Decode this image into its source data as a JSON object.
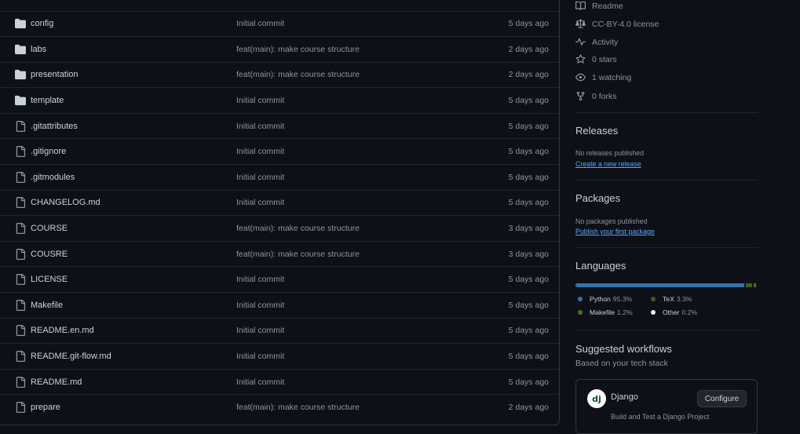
{
  "files": [
    {
      "type": "folder",
      "name": "config",
      "message": "Initial commit",
      "age": "5 days ago"
    },
    {
      "type": "folder",
      "name": "labs",
      "message": "feat(main): make course structure",
      "age": "2 days ago"
    },
    {
      "type": "folder",
      "name": "presentation",
      "message": "feat(main): make course structure",
      "age": "2 days ago"
    },
    {
      "type": "folder",
      "name": "template",
      "message": "Initial commit",
      "age": "5 days ago"
    },
    {
      "type": "file",
      "name": ".gitattributes",
      "message": "Initial commit",
      "age": "5 days ago"
    },
    {
      "type": "file",
      "name": ".gitignore",
      "message": "Initial commit",
      "age": "5 days ago"
    },
    {
      "type": "file",
      "name": ".gitmodules",
      "message": "Initial commit",
      "age": "5 days ago"
    },
    {
      "type": "file",
      "name": "CHANGELOG.md",
      "message": "Initial commit",
      "age": "5 days ago"
    },
    {
      "type": "file",
      "name": "COURSE",
      "message": "feat(main): make course structure",
      "age": "3 days ago"
    },
    {
      "type": "file",
      "name": "COUSRE",
      "message": "feat(main): make course structure",
      "age": "3 days ago"
    },
    {
      "type": "file",
      "name": "LICENSE",
      "message": "Initial commit",
      "age": "5 days ago"
    },
    {
      "type": "file",
      "name": "Makefile",
      "message": "Initial commit",
      "age": "5 days ago"
    },
    {
      "type": "file",
      "name": "README.en.md",
      "message": "Initial commit",
      "age": "5 days ago"
    },
    {
      "type": "file",
      "name": "README.git-flow.md",
      "message": "Initial commit",
      "age": "5 days ago"
    },
    {
      "type": "file",
      "name": "README.md",
      "message": "Initial commit",
      "age": "5 days ago"
    },
    {
      "type": "file",
      "name": "prepare",
      "message": "feat(main): make course structure",
      "age": "2 days ago"
    }
  ],
  "about": {
    "readme": "Readme",
    "license": "CC-BY-4.0 license",
    "activity": "Activity",
    "stars": "0 stars",
    "watching": "1 watching",
    "forks": "0 forks"
  },
  "releases": {
    "title": "Releases",
    "empty": "No releases published",
    "link": "Create a new release"
  },
  "packages": {
    "title": "Packages",
    "empty": "No packages published",
    "link": "Publish your first package"
  },
  "languages": {
    "title": "Languages",
    "items": [
      {
        "name": "Python",
        "pct": "95.3%",
        "value": 95.3,
        "color": "#3572A5"
      },
      {
        "name": "TeX",
        "pct": "3.3%",
        "value": 3.3,
        "color": "#3D6117"
      },
      {
        "name": "Makefile",
        "pct": "1.2%",
        "value": 1.2,
        "color": "#427819"
      },
      {
        "name": "Other",
        "pct": "0.2%",
        "value": 0.2,
        "color": "#ededed"
      }
    ]
  },
  "workflows": {
    "title": "Suggested workflows",
    "subtitle": "Based on your tech stack",
    "card": {
      "logo": "dj",
      "name": "Django",
      "button": "Configure",
      "description": "Build and Test a Django Project"
    }
  },
  "icons": {
    "folder": "folder-icon",
    "file": "file-icon"
  },
  "colors": {
    "bg": "#0d1117",
    "border": "#21262d",
    "link": "#58a6ff",
    "muted": "#8b949e",
    "folder": "#c9d1d9"
  }
}
